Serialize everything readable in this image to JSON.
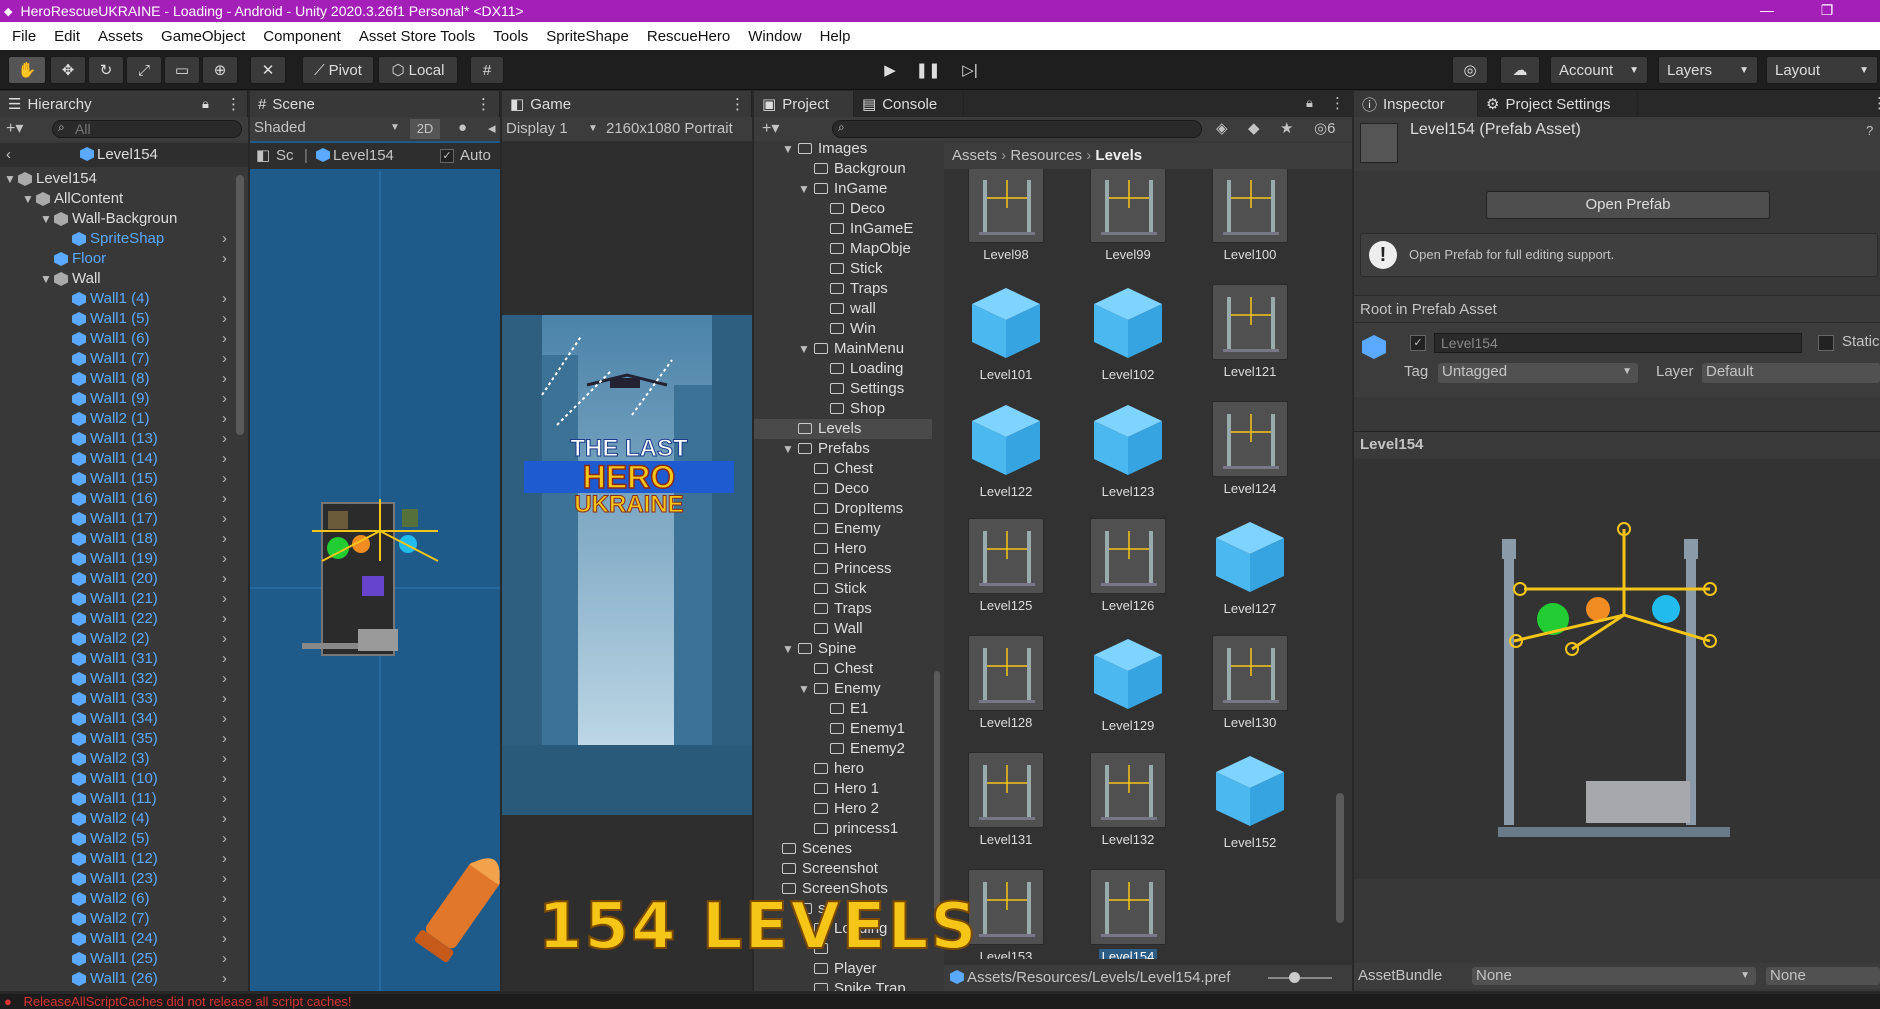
{
  "window": {
    "title": "HeroRescueUKRAINE - Loading - Android - Unity 2020.3.26f1 Personal* <DX11>"
  },
  "menu": [
    "File",
    "Edit",
    "Assets",
    "GameObject",
    "Component",
    "Asset Store Tools",
    "Tools",
    "SpriteShape",
    "RescueHero",
    "Window",
    "Help"
  ],
  "toolbar": {
    "pivot": "Pivot",
    "local": "Local",
    "account": "Account",
    "layers": "Layers",
    "layout": "Layout"
  },
  "hierarchy": {
    "tab": "Hierarchy",
    "search_placeholder": "All",
    "root": "Level154",
    "items": [
      {
        "label": "Level154",
        "depth": 0,
        "type": "dark"
      },
      {
        "label": "AllContent",
        "depth": 1,
        "type": "dark"
      },
      {
        "label": "Wall-Backgroun",
        "depth": 2,
        "type": "dark"
      },
      {
        "label": "SpriteShap",
        "depth": 3,
        "type": "blue"
      },
      {
        "label": "Floor",
        "depth": 2,
        "type": "blue"
      },
      {
        "label": "Wall",
        "depth": 2,
        "type": "dark"
      },
      {
        "label": "Wall1 (4)",
        "depth": 3,
        "type": "blue"
      },
      {
        "label": "Wall1 (5)",
        "depth": 3,
        "type": "blue"
      },
      {
        "label": "Wall1 (6)",
        "depth": 3,
        "type": "blue"
      },
      {
        "label": "Wall1 (7)",
        "depth": 3,
        "type": "blue"
      },
      {
        "label": "Wall1 (8)",
        "depth": 3,
        "type": "blue"
      },
      {
        "label": "Wall1 (9)",
        "depth": 3,
        "type": "blue"
      },
      {
        "label": "Wall2 (1)",
        "depth": 3,
        "type": "blue"
      },
      {
        "label": "Wall1 (13)",
        "depth": 3,
        "type": "blue"
      },
      {
        "label": "Wall1 (14)",
        "depth": 3,
        "type": "blue"
      },
      {
        "label": "Wall1 (15)",
        "depth": 3,
        "type": "blue"
      },
      {
        "label": "Wall1 (16)",
        "depth": 3,
        "type": "blue"
      },
      {
        "label": "Wall1 (17)",
        "depth": 3,
        "type": "blue"
      },
      {
        "label": "Wall1 (18)",
        "depth": 3,
        "type": "blue"
      },
      {
        "label": "Wall1 (19)",
        "depth": 3,
        "type": "blue"
      },
      {
        "label": "Wall1 (20)",
        "depth": 3,
        "type": "blue"
      },
      {
        "label": "Wall1 (21)",
        "depth": 3,
        "type": "blue"
      },
      {
        "label": "Wall1 (22)",
        "depth": 3,
        "type": "blue"
      },
      {
        "label": "Wall2 (2)",
        "depth": 3,
        "type": "blue"
      },
      {
        "label": "Wall1 (31)",
        "depth": 3,
        "type": "blue"
      },
      {
        "label": "Wall1 (32)",
        "depth": 3,
        "type": "blue"
      },
      {
        "label": "Wall1 (33)",
        "depth": 3,
        "type": "blue"
      },
      {
        "label": "Wall1 (34)",
        "depth": 3,
        "type": "blue"
      },
      {
        "label": "Wall1 (35)",
        "depth": 3,
        "type": "blue"
      },
      {
        "label": "Wall2 (3)",
        "depth": 3,
        "type": "blue"
      },
      {
        "label": "Wall1 (10)",
        "depth": 3,
        "type": "blue"
      },
      {
        "label": "Wall1 (11)",
        "depth": 3,
        "type": "blue"
      },
      {
        "label": "Wall2 (4)",
        "depth": 3,
        "type": "blue"
      },
      {
        "label": "Wall2 (5)",
        "depth": 3,
        "type": "blue"
      },
      {
        "label": "Wall1 (12)",
        "depth": 3,
        "type": "blue"
      },
      {
        "label": "Wall1 (23)",
        "depth": 3,
        "type": "blue"
      },
      {
        "label": "Wall2 (6)",
        "depth": 3,
        "type": "blue"
      },
      {
        "label": "Wall2 (7)",
        "depth": 3,
        "type": "blue"
      },
      {
        "label": "Wall1 (24)",
        "depth": 3,
        "type": "blue"
      },
      {
        "label": "Wall1 (25)",
        "depth": 3,
        "type": "blue"
      },
      {
        "label": "Wall1 (26)",
        "depth": 3,
        "type": "blue"
      }
    ]
  },
  "scene": {
    "tab": "Scene",
    "shading": "Shaded",
    "mode2d": "2D",
    "crumb_short": "Sc",
    "crumb": "Level154",
    "auto": "Auto"
  },
  "game": {
    "tab": "Game",
    "display": "Display 1",
    "resolution": "2160x1080 Portrait",
    "logo_line1": "THE LAST",
    "logo_line2": "HERO",
    "logo_line3": "UKRAINE"
  },
  "overlay": {
    "levels_text": "154 LEVELS"
  },
  "project": {
    "tab": "Project",
    "console_tab": "Console",
    "hidden_count": "6",
    "tree": [
      {
        "label": "Images",
        "depth": 1,
        "open": true
      },
      {
        "label": "Backgroun",
        "depth": 2
      },
      {
        "label": "InGame",
        "depth": 2,
        "open": true
      },
      {
        "label": "Deco",
        "depth": 3
      },
      {
        "label": "InGameE",
        "depth": 3
      },
      {
        "label": "MapObje",
        "depth": 3
      },
      {
        "label": "Stick",
        "depth": 3
      },
      {
        "label": "Traps",
        "depth": 3
      },
      {
        "label": "wall",
        "depth": 3
      },
      {
        "label": "Win",
        "depth": 3
      },
      {
        "label": "MainMenu",
        "depth": 2,
        "open": true
      },
      {
        "label": "Loading",
        "depth": 3
      },
      {
        "label": "Settings",
        "depth": 3
      },
      {
        "label": "Shop",
        "depth": 3
      },
      {
        "label": "Levels",
        "depth": 1,
        "selected": true
      },
      {
        "label": "Prefabs",
        "depth": 1,
        "open": true
      },
      {
        "label": "Chest",
        "depth": 2
      },
      {
        "label": "Deco",
        "depth": 2
      },
      {
        "label": "DropItems",
        "depth": 2
      },
      {
        "label": "Enemy",
        "depth": 2
      },
      {
        "label": "Hero",
        "depth": 2
      },
      {
        "label": "Princess",
        "depth": 2
      },
      {
        "label": "Stick",
        "depth": 2
      },
      {
        "label": "Traps",
        "depth": 2
      },
      {
        "label": "Wall",
        "depth": 2
      },
      {
        "label": "Spine",
        "depth": 1,
        "open": true
      },
      {
        "label": "Chest",
        "depth": 2
      },
      {
        "label": "Enemy",
        "depth": 2,
        "open": true
      },
      {
        "label": "E1",
        "depth": 3
      },
      {
        "label": "Enemy1",
        "depth": 3
      },
      {
        "label": "Enemy2",
        "depth": 3
      },
      {
        "label": "hero",
        "depth": 2
      },
      {
        "label": "Hero 1",
        "depth": 2
      },
      {
        "label": "Hero 2",
        "depth": 2
      },
      {
        "label": "princess1",
        "depth": 2
      },
      {
        "label": "Scenes",
        "depth": 0
      },
      {
        "label": "Screenshot",
        "depth": 0
      },
      {
        "label": "ScreenShots",
        "depth": 0
      },
      {
        "label": "s",
        "depth": 1
      },
      {
        "label": "Loading",
        "depth": 2
      },
      {
        "label": "",
        "depth": 2
      },
      {
        "label": "Player",
        "depth": 2
      },
      {
        "label": "Spike Trap",
        "depth": 2
      }
    ],
    "breadcrumb": [
      "Assets",
      "Resources",
      "Levels"
    ],
    "assets": [
      {
        "name": "Level98",
        "kind": "thumb"
      },
      {
        "name": "Level99",
        "kind": "thumb"
      },
      {
        "name": "Level100",
        "kind": "thumb"
      },
      {
        "name": "Level101",
        "kind": "cube"
      },
      {
        "name": "Level102",
        "kind": "cube"
      },
      {
        "name": "Level121",
        "kind": "thumb"
      },
      {
        "name": "Level122",
        "kind": "cube"
      },
      {
        "name": "Level123",
        "kind": "cube"
      },
      {
        "name": "Level124",
        "kind": "thumb"
      },
      {
        "name": "Level125",
        "kind": "thumb"
      },
      {
        "name": "Level126",
        "kind": "thumb"
      },
      {
        "name": "Level127",
        "kind": "cube"
      },
      {
        "name": "Level128",
        "kind": "thumb"
      },
      {
        "name": "Level129",
        "kind": "cube"
      },
      {
        "name": "Level130",
        "kind": "thumb"
      },
      {
        "name": "Level131",
        "kind": "thumb"
      },
      {
        "name": "Level132",
        "kind": "thumb"
      },
      {
        "name": "Level152",
        "kind": "cube"
      },
      {
        "name": "Level153",
        "kind": "thumb"
      },
      {
        "name": "Level154",
        "kind": "thumb",
        "selected": true
      }
    ],
    "footer_path": "Assets/Resources/Levels/Level154.pref"
  },
  "inspector": {
    "tab": "Inspector",
    "settings_tab": "Project Settings",
    "title": "Level154 (Prefab Asset)",
    "open_prefab": "Open Prefab",
    "info": "Open Prefab for full editing support.",
    "root_label": "Root in Prefab Asset",
    "object_name": "Level154",
    "static": "Static",
    "tag_label": "Tag",
    "tag_value": "Untagged",
    "layer_label": "Layer",
    "layer_value": "Default",
    "preview_title": "Level154",
    "assetbundle_label": "AssetBundle",
    "assetbundle_value": "None",
    "assetbundle_variant": "None"
  },
  "status": {
    "message": "ReleaseAllScriptCaches did not release all script caches!"
  },
  "colors": {
    "title_bar": "#a31fb8",
    "accent_blue": "#5aa9ff",
    "levels_text": "#f5c518"
  }
}
